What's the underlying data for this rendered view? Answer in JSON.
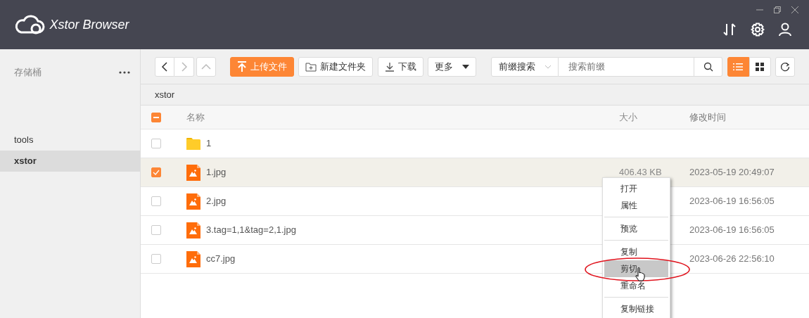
{
  "window": {
    "title": "Xstor Browser"
  },
  "sidebar": {
    "heading": "存储桶",
    "items": [
      {
        "label": "tools",
        "selected": false
      },
      {
        "label": "xstor",
        "selected": true
      }
    ]
  },
  "toolbar": {
    "upload": "上传文件",
    "new_folder": "新建文件夹",
    "download": "下载",
    "more": "更多",
    "search_mode": "前缀搜索",
    "search_placeholder": "搜索前缀",
    "views": [
      {
        "kind": "list",
        "selected": true
      },
      {
        "kind": "grid",
        "selected": false
      }
    ]
  },
  "breadcrumb": "xstor",
  "table": {
    "select_all_indeterminate": true,
    "columns": [
      "名称",
      "大小",
      "修改时间"
    ],
    "rows": [
      {
        "kind": "folder",
        "name": "1",
        "checked": false
      },
      {
        "kind": "image",
        "name": "1.jpg",
        "size": "406.43 KB",
        "modified": "2023-05-19 20:49:07",
        "checked": true
      },
      {
        "kind": "image",
        "name": "2.jpg",
        "modified": "2023-06-19 16:56:05",
        "checked": false
      },
      {
        "kind": "image",
        "name": "3.tag=1,1&tag=2,1.jpg",
        "modified": "2023-06-19 16:56:05",
        "checked": false
      },
      {
        "kind": "image",
        "name": "cc7.jpg",
        "modified": "2023-06-26 22:56:10",
        "checked": false
      }
    ]
  },
  "context_menu": {
    "groups": [
      {
        "items": [
          {
            "label": "打开",
            "selected": false
          },
          {
            "label": "属性",
            "selected": false
          }
        ]
      },
      {
        "items": [
          {
            "label": "预览",
            "selected": false
          }
        ]
      },
      {
        "items": [
          {
            "label": "复制",
            "selected": false
          },
          {
            "label": "剪切",
            "selected": true
          },
          {
            "label": "重命名",
            "selected": false
          }
        ]
      },
      {
        "items": [
          {
            "label": "复制链接",
            "selected": false
          }
        ]
      }
    ]
  }
}
